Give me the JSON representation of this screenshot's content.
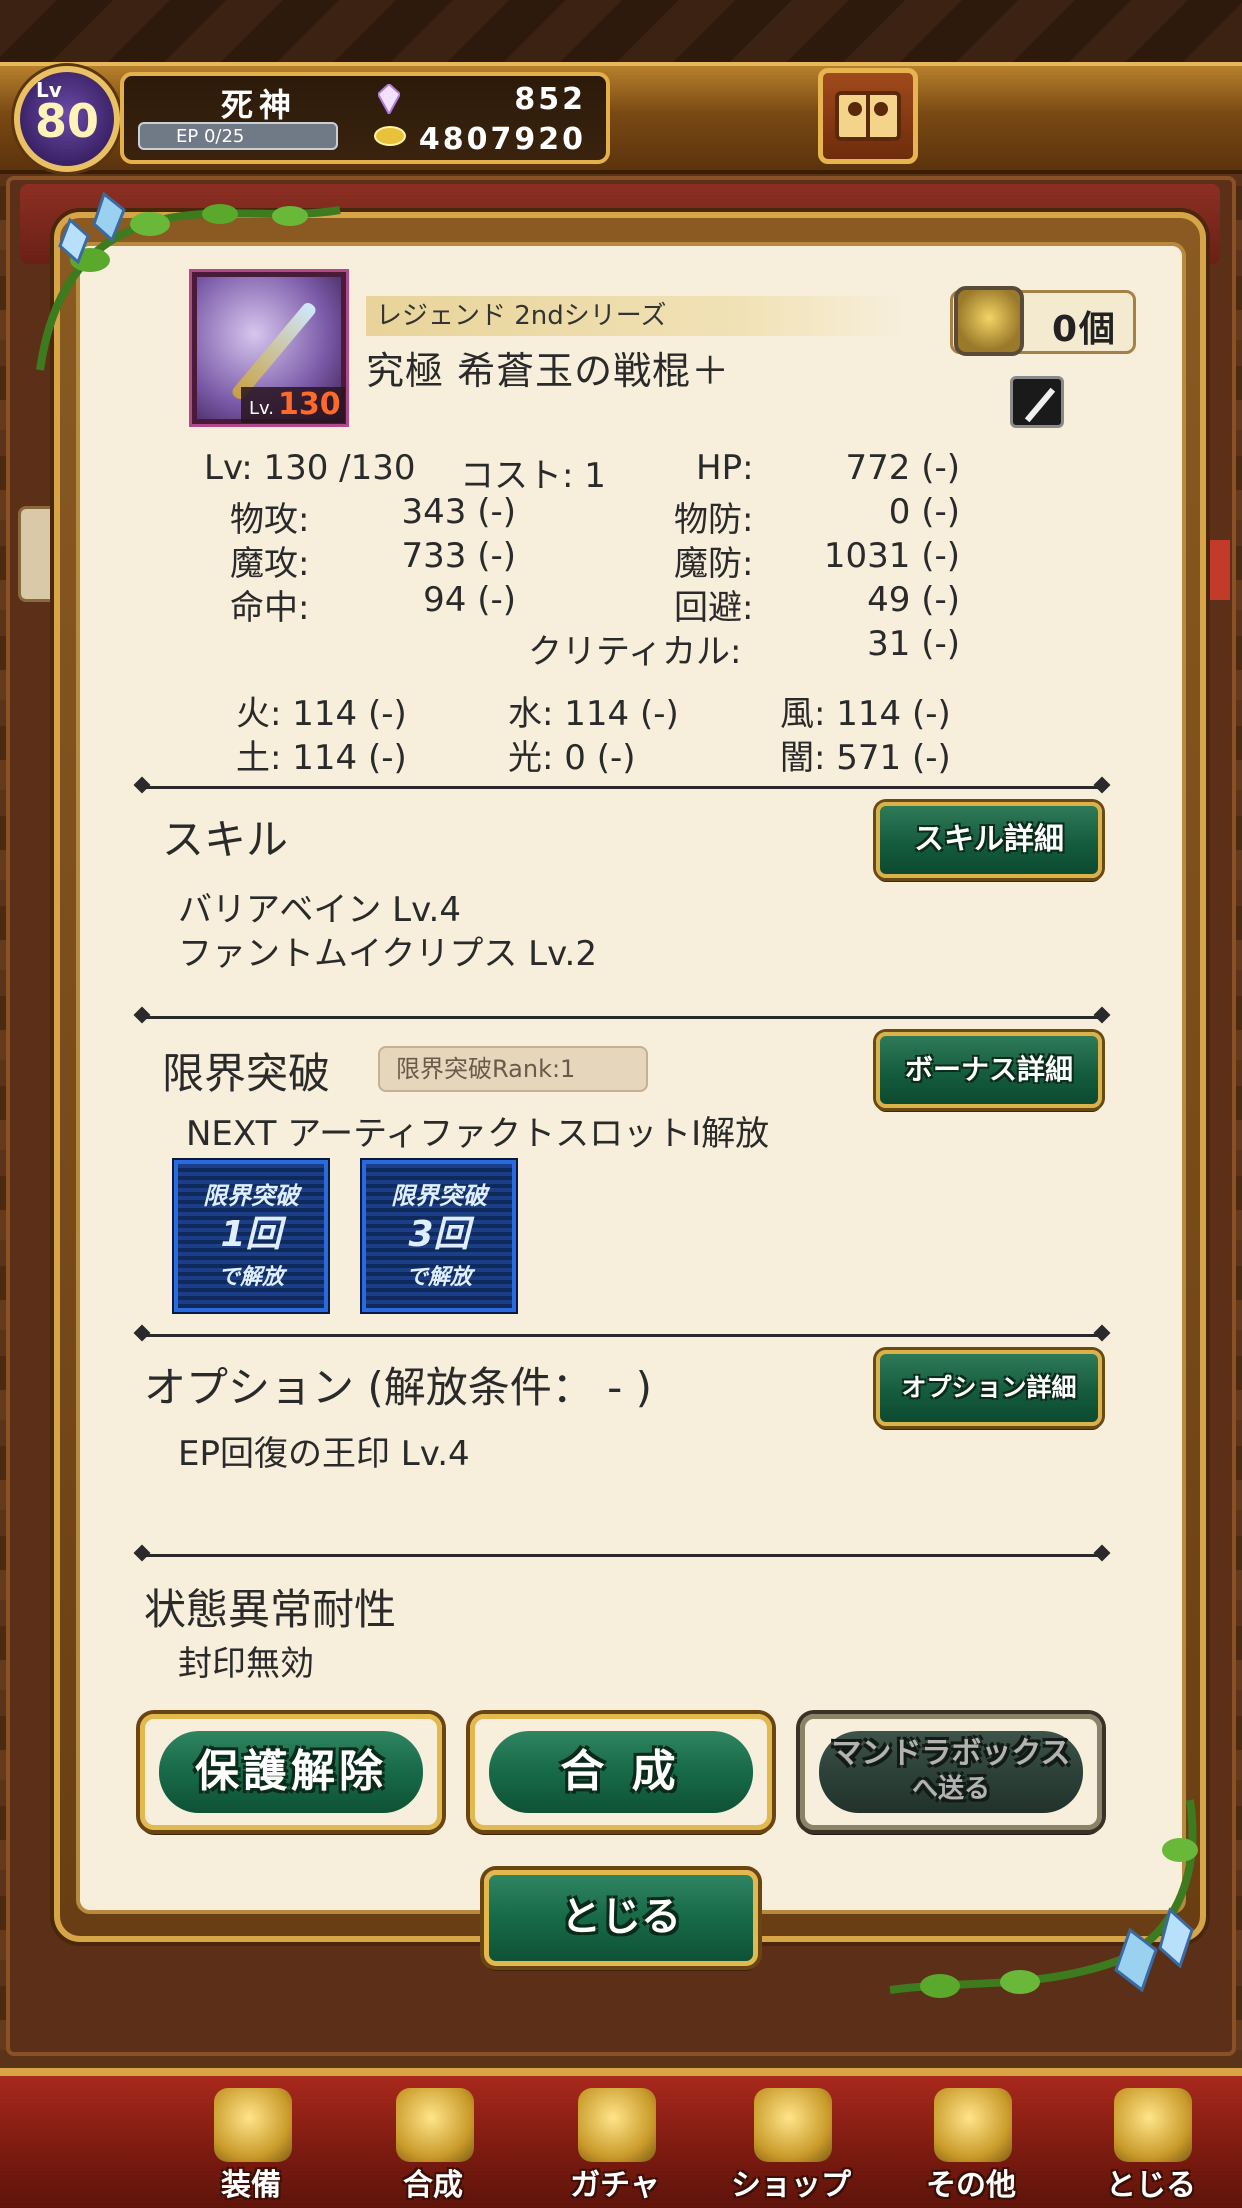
{
  "player": {
    "level_tag": "Lv",
    "level": "80",
    "name": "死神",
    "ep": "EP 0/25",
    "crystals": "852",
    "coins": "4807920"
  },
  "item": {
    "thumb_level_prefix": "Lv.",
    "thumb_level": "130",
    "series": "レジェンド 2ndシリーズ",
    "name": "究極 希蒼玉の戦棍＋",
    "owned_count": "0個"
  },
  "stats": {
    "lv": "Lv: 130 /130",
    "cost": "コスト: 1",
    "hp_label": "HP:",
    "hp_value": "772 (-)",
    "patk_label": "物攻:",
    "patk_value": "343 (-)",
    "pdef_label": "物防:",
    "pdef_value": "0 (-)",
    "matk_label": "魔攻:",
    "matk_value": "733 (-)",
    "mdef_label": "魔防:",
    "mdef_value": "1031 (-)",
    "acc_label": "命中:",
    "acc_value": "94 (-)",
    "eva_label": "回避:",
    "eva_value": "49 (-)",
    "crit_label": "クリティカル:",
    "crit_value": "31 (-)",
    "fire": "火:  114 (-)",
    "water": "水:  114 (-)",
    "wind": "風:  114 (-)",
    "earth": "土:  114 (-)",
    "light": "光:      0 (-)",
    "dark": "闇:  571 (-)"
  },
  "skill": {
    "title": "スキル",
    "detail_button": "スキル詳細",
    "skills": [
      "バリアベイン  Lv.4",
      "ファントムイクリプス  Lv.2"
    ]
  },
  "limit_break": {
    "title": "限界突破",
    "rank": "限界突破Rank:1",
    "bonus_button": "ボーナス詳細",
    "next": "NEXT アーティファクトスロットⅠ解放",
    "badges": [
      {
        "l1": "限界突破",
        "l2": "1回",
        "l3": "で解放"
      },
      {
        "l1": "限界突破",
        "l2": "3回",
        "l3": "で解放"
      }
    ]
  },
  "option": {
    "title": "オプション (解放条件：  - )",
    "detail_button": "オプション詳細",
    "text": "EP回復の王印 Lv.4"
  },
  "resistance": {
    "title": "状態異常耐性",
    "text": "封印無効"
  },
  "actions": {
    "unprotect": "保護解除",
    "fuse": "合 成",
    "send_line1": "マンドラボックス",
    "send_line2": "へ送る",
    "close": "とじる"
  },
  "nav": [
    {
      "label": "装備",
      "icon": "equipment-icon"
    },
    {
      "label": "合成",
      "icon": "hammer-icon"
    },
    {
      "label": "ガチャ",
      "icon": "gacha-icon"
    },
    {
      "label": "ショップ",
      "icon": "shop-icon"
    },
    {
      "label": "その他",
      "icon": "gear-icon"
    },
    {
      "label": "とじる",
      "icon": "close-icon"
    }
  ],
  "colors": {
    "button_green": "#176a48",
    "gold_border": "#d9b24a",
    "panel_bg": "#f7efdc",
    "nav_red": "#a8281c"
  }
}
